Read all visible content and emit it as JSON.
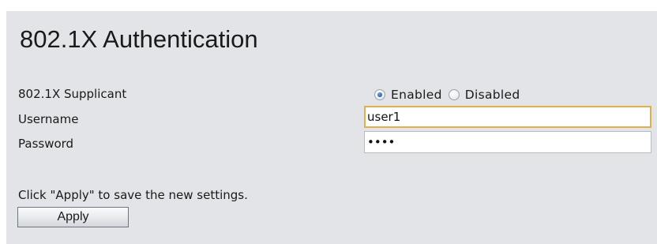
{
  "page": {
    "title": "802.1X Authentication"
  },
  "form": {
    "supplicant": {
      "label": "802.1X Supplicant",
      "options": [
        {
          "label": "Enabled",
          "selected": true
        },
        {
          "label": "Disabled",
          "selected": false
        }
      ]
    },
    "username": {
      "label": "Username",
      "value": "user1"
    },
    "password": {
      "label": "Password",
      "value": "user"
    }
  },
  "footer": {
    "hint": "Click \"Apply\" to save the new settings.",
    "apply_label": "Apply"
  },
  "colors": {
    "panel_background": "#e2e4e7",
    "focus_border": "#e2b04a",
    "radio_selected": "#2a5db0"
  }
}
